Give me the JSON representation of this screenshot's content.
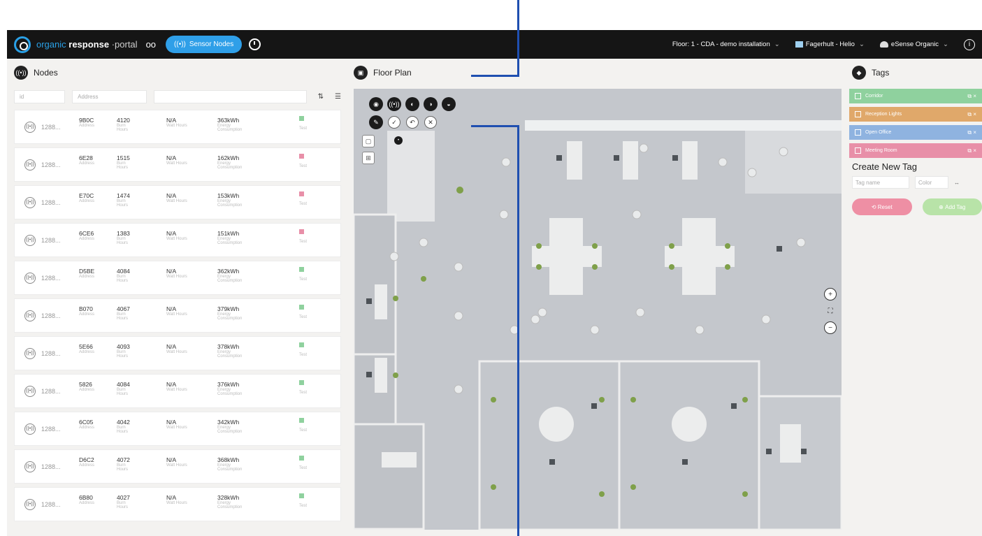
{
  "topbar": {
    "brand_part1": "organic",
    "brand_part2": "response",
    "brand_part3": "·portal",
    "link_glyph": "oo",
    "sensor_nodes_label": "Sensor Nodes",
    "floor_selector": "Floor: 1 - CDA - demo installation",
    "site_selector": "Fagerhult - Helio",
    "user_menu": "eSense Organic",
    "accent_color": "#2f9fe8"
  },
  "nodes_panel": {
    "title": "Nodes",
    "filter_id_placeholder": "id",
    "filter_address_placeholder": "Address",
    "nodes": [
      {
        "id": "1288...",
        "address": "9B0C",
        "burn": "4120",
        "watt": "N/A",
        "energy": "363kWh",
        "status_color": "#8fd19e",
        "status": "Test"
      },
      {
        "id": "1288...",
        "address": "6E28",
        "burn": "1515",
        "watt": "N/A",
        "energy": "162kWh",
        "status_color": "#e88fa8",
        "status": "Test"
      },
      {
        "id": "1288...",
        "address": "E70C",
        "burn": "1474",
        "watt": "N/A",
        "energy": "153kWh",
        "status_color": "#e88fa8",
        "status": "Test"
      },
      {
        "id": "1288...",
        "address": "6CE6",
        "burn": "1383",
        "watt": "N/A",
        "energy": "151kWh",
        "status_color": "#e88fa8",
        "status": "Test"
      },
      {
        "id": "1288...",
        "address": "D5BE",
        "burn": "4084",
        "watt": "N/A",
        "energy": "362kWh",
        "status_color": "#8fd19e",
        "status": "Test"
      },
      {
        "id": "1288...",
        "address": "B070",
        "burn": "4067",
        "watt": "N/A",
        "energy": "379kWh",
        "status_color": "#8fd19e",
        "status": "Test"
      },
      {
        "id": "1288...",
        "address": "5E66",
        "burn": "4093",
        "watt": "N/A",
        "energy": "378kWh",
        "status_color": "#8fd19e",
        "status": "Test"
      },
      {
        "id": "1288...",
        "address": "5826",
        "burn": "4084",
        "watt": "N/A",
        "energy": "376kWh",
        "status_color": "#8fd19e",
        "status": "Test"
      },
      {
        "id": "1288...",
        "address": "6C05",
        "burn": "4042",
        "watt": "N/A",
        "energy": "342kWh",
        "status_color": "#8fd19e",
        "status": "Test"
      },
      {
        "id": "1288...",
        "address": "D6C2",
        "burn": "4072",
        "watt": "N/A",
        "energy": "368kWh",
        "status_color": "#8fd19e",
        "status": "Test"
      },
      {
        "id": "1288...",
        "address": "6B80",
        "burn": "4027",
        "watt": "N/A",
        "energy": "328kWh",
        "status_color": "#8fd19e",
        "status": "Test"
      }
    ],
    "col_labels": {
      "address": "Address",
      "burn": "Burn Hours",
      "watt": "Watt Hours",
      "energy": "Energy Consumption"
    }
  },
  "floor_plan": {
    "title": "Floor Plan"
  },
  "tags_panel": {
    "title": "Tags",
    "tags": [
      {
        "label": "Corridor",
        "color": "#8fd19e"
      },
      {
        "label": "Reception Lights",
        "color": "#e0a86a"
      },
      {
        "label": "Open Office",
        "color": "#8fb3e0"
      },
      {
        "label": "Meeting Room",
        "color": "#e88fa8"
      }
    ],
    "create_title": "Create New Tag",
    "tag_name_placeholder": "Tag name",
    "color_placeholder": "Color",
    "reset_label": "Reset",
    "add_label": "Add Tag",
    "reset_color": "#ee8fa4",
    "add_color": "#b8e3a8"
  }
}
